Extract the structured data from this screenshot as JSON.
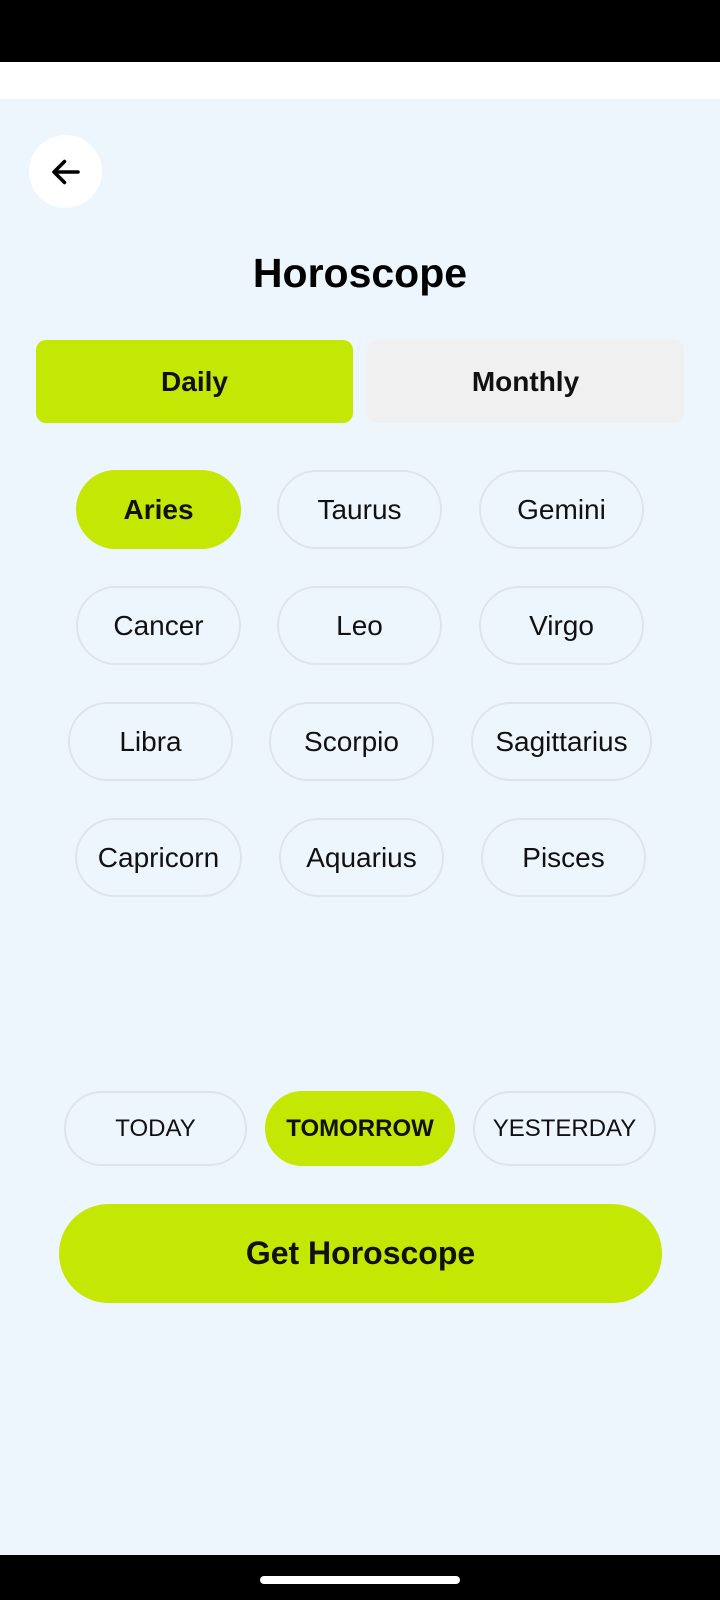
{
  "title": "Horoscope",
  "tabs": [
    {
      "label": "Daily",
      "selected": true
    },
    {
      "label": "Monthly",
      "selected": false
    }
  ],
  "signs": [
    {
      "label": "Aries",
      "selected": true
    },
    {
      "label": "Taurus",
      "selected": false
    },
    {
      "label": "Gemini",
      "selected": false
    },
    {
      "label": "Cancer",
      "selected": false
    },
    {
      "label": "Leo",
      "selected": false
    },
    {
      "label": "Virgo",
      "selected": false
    },
    {
      "label": "Libra",
      "selected": false
    },
    {
      "label": "Scorpio",
      "selected": false
    },
    {
      "label": "Sagittarius",
      "selected": false
    },
    {
      "label": "Capricorn",
      "selected": false
    },
    {
      "label": "Aquarius",
      "selected": false
    },
    {
      "label": "Pisces",
      "selected": false
    }
  ],
  "days": [
    {
      "label": "TODAY",
      "selected": false
    },
    {
      "label": "TOMORROW",
      "selected": true
    },
    {
      "label": "YESTERDAY",
      "selected": false
    }
  ],
  "action": {
    "label": "Get Horoscope"
  },
  "icons": {
    "back": "arrow-left-icon"
  },
  "colors": {
    "accent": "#c4e804",
    "background": "#eef6fd",
    "tab_inactive": "#f0f0f0",
    "pill_border": "#dfe4ea"
  }
}
